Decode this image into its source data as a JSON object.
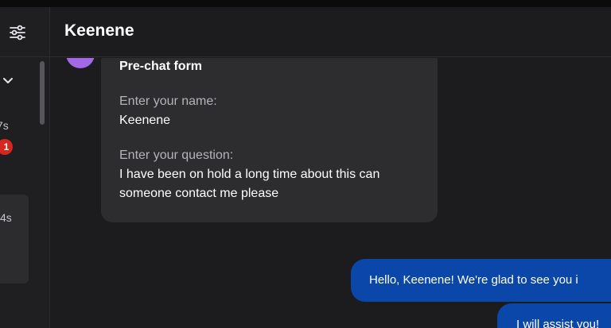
{
  "header": {
    "title": "Keenene"
  },
  "sidebar": {
    "conversations": [
      {
        "time": "7s",
        "unread": "1"
      },
      {
        "time": "4s"
      }
    ]
  },
  "form": {
    "title": "Pre-chat form",
    "fields": [
      {
        "label": "Enter your name:",
        "value": "Keenene"
      },
      {
        "label": "Enter your question:",
        "value": "I have been on hold a long time about this can someone contact me please"
      }
    ]
  },
  "messages": [
    {
      "text": "Hello, Keenene! We're glad to see you i"
    },
    {
      "text": "I will assist you!"
    }
  ],
  "colors": {
    "accent_bubble": "#0a47a8",
    "avatar": "#a368e8",
    "unread_badge": "#d7261e"
  }
}
